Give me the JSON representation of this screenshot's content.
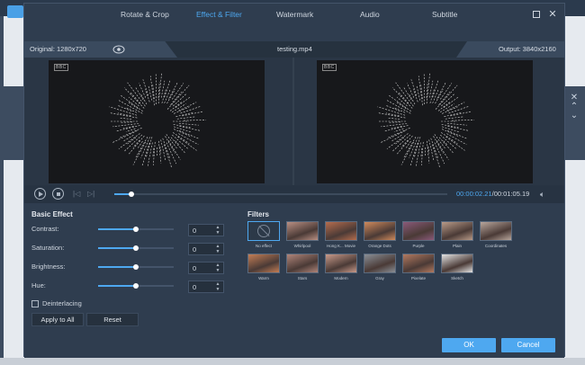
{
  "tabs": [
    {
      "label": "Rotate & Crop"
    },
    {
      "label": "Effect & Filter"
    },
    {
      "label": "Watermark"
    },
    {
      "label": "Audio"
    },
    {
      "label": "Subtitle"
    }
  ],
  "active_tab": "Effect & Filter",
  "window": {
    "minimize_icon": "minimize-icon",
    "close_icon": "close-icon"
  },
  "info": {
    "original": "Original: 1280x720",
    "filename": "testing.mp4",
    "output": "Output: 3840x2160"
  },
  "video": {
    "watermark": "BBC"
  },
  "playback": {
    "current": "00:00:02.21",
    "total": "/00:01:05.19",
    "progress": 0.05
  },
  "basic_effect": {
    "title": "Basic Effect",
    "sliders": [
      {
        "label": "Contrast:",
        "value": "0",
        "level": 0.5
      },
      {
        "label": "Saturation:",
        "value": "0",
        "level": 0.5
      },
      {
        "label": "Brightness:",
        "value": "0",
        "level": 0.5
      },
      {
        "label": "Hue:",
        "value": "0",
        "level": 0.5
      }
    ],
    "deinterlacing": "Deinterlacing",
    "apply_all": "Apply to All",
    "reset": "Reset"
  },
  "filters": {
    "title": "Filters",
    "items": [
      {
        "label": "No effect",
        "color": "#2c3948",
        "selected": true
      },
      {
        "label": "Whirlpool",
        "color": "#b98f83"
      },
      {
        "label": "Hong K... Movie",
        "color": "#b56d4e"
      },
      {
        "label": "Orange Dots",
        "color": "#d08a5c"
      },
      {
        "label": "Purple",
        "color": "#8a5a7a"
      },
      {
        "label": "Plain",
        "color": "#b89a88"
      },
      {
        "label": "Coordinates",
        "color": "#b8a69c"
      },
      {
        "label": "Warm",
        "color": "#c47e55"
      },
      {
        "label": "Stars",
        "color": "#b0857a"
      },
      {
        "label": "Modern",
        "color": "#c99a8a"
      },
      {
        "label": "Gray",
        "color": "#8a8f96"
      },
      {
        "label": "Pixelate",
        "color": "#b37a60"
      },
      {
        "label": "Sketch",
        "color": "#e4e4e4"
      }
    ]
  },
  "actions": {
    "ok": "OK",
    "cancel": "Cancel"
  }
}
